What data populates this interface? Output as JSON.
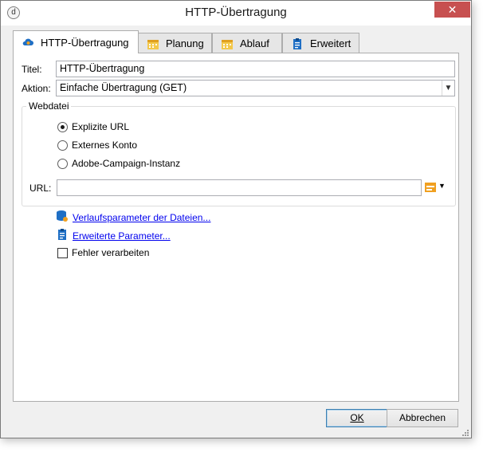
{
  "window": {
    "title": "HTTP-Übertragung",
    "close_glyph": "✕",
    "app_icon": "d"
  },
  "tabs": [
    {
      "label": "HTTP-Übertragung",
      "icon": "cloud-icon",
      "active": true
    },
    {
      "label": "Planung",
      "icon": "calendar-icon",
      "active": false
    },
    {
      "label": "Ablauf",
      "icon": "calendar-icon",
      "active": false
    },
    {
      "label": "Erweitert",
      "icon": "clipboard-icon",
      "active": false
    }
  ],
  "form": {
    "title_label": "Titel:",
    "title_value": "HTTP-Übertragung",
    "action_label": "Aktion:",
    "action_value": "Einfache Übertragung (GET)"
  },
  "webfile": {
    "group_label": "Webdatei",
    "options": [
      {
        "label": "Explizite URL",
        "checked": true
      },
      {
        "label": "Externes Konto",
        "checked": false
      },
      {
        "label": "Adobe-Campaign-Instanz",
        "checked": false
      }
    ],
    "url_label": "URL:",
    "url_value": ""
  },
  "links": {
    "history_params": "Verlaufsparameter der Dateien...",
    "advanced_params": "Erweiterte Parameter..."
  },
  "error_handling": {
    "label": "Fehler verarbeiten",
    "checked": false
  },
  "buttons": {
    "ok": "OK",
    "cancel": "Abbrechen"
  },
  "colors": {
    "link": "#0000ee",
    "close_button": "#c75050",
    "accent_orange": "#f0a020",
    "accent_blue": "#1f6fc5"
  }
}
